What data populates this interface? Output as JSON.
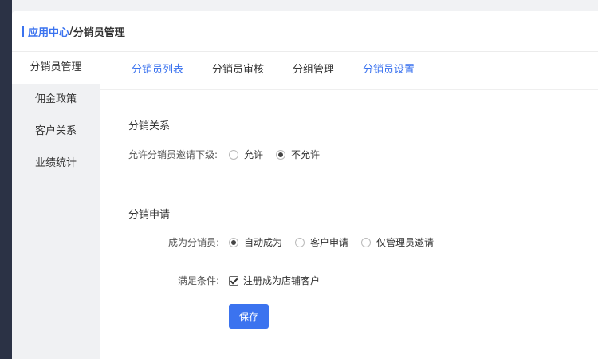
{
  "breadcrumb": {
    "parent": "应用中心",
    "separator": "/",
    "current": "分销员管理"
  },
  "sidebar": {
    "items": [
      {
        "label": "分销员管理",
        "active": true
      },
      {
        "label": "佣金政策",
        "active": false
      },
      {
        "label": "客户关系",
        "active": false
      },
      {
        "label": "业绩统计",
        "active": false
      }
    ]
  },
  "tabs": [
    {
      "label": "分销员列表",
      "active": false
    },
    {
      "label": "分销员审核",
      "active": false
    },
    {
      "label": "分组管理",
      "active": false
    },
    {
      "label": "分销员设置",
      "active": true
    }
  ],
  "section1": {
    "title": "分销关系",
    "invite_label": "允许分销员邀请下级:",
    "invite_options": [
      {
        "label": "允许",
        "checked": false
      },
      {
        "label": "不允许",
        "checked": true
      }
    ]
  },
  "section2": {
    "title": "分销申请",
    "become_label": "成为分销员:",
    "become_options": [
      {
        "label": "自动成为",
        "checked": true
      },
      {
        "label": "客户申请",
        "checked": false
      },
      {
        "label": "仅管理员邀请",
        "checked": false
      }
    ],
    "condition_label": "满足条件:",
    "condition_checkbox": {
      "label": "注册成为店铺客户",
      "checked": true
    }
  },
  "save_label": "保存",
  "colors": {
    "accent": "#3b73ef",
    "sidebar_bg": "#f0f1f3",
    "dark_strip": "#2b3245"
  }
}
